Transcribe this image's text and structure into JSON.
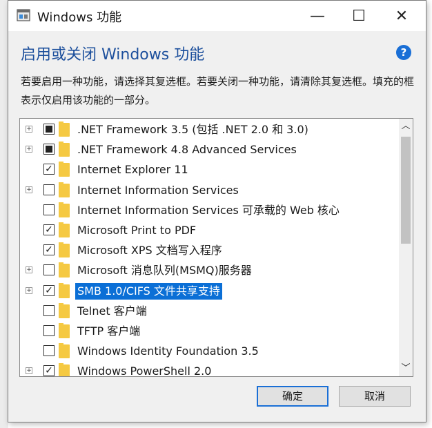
{
  "window": {
    "title": "Windows 功能",
    "controls": {
      "minimize": "—",
      "maximize": "☐",
      "close": "✕"
    }
  },
  "heading": "启用或关闭 Windows 功能",
  "help_icon": "?",
  "description": "若要启用一种功能，请选择其复选框。若要关闭一种功能，请清除其复选框。填充的框表示仅启用该功能的一部分。",
  "features": [
    {
      "label": ".NET Framework 3.5 (包括 .NET 2.0 和 3.0)",
      "state": "partial",
      "expandable": true
    },
    {
      "label": ".NET Framework 4.8 Advanced Services",
      "state": "partial",
      "expandable": true
    },
    {
      "label": "Internet Explorer 11",
      "state": "checked",
      "expandable": false
    },
    {
      "label": "Internet Information Services",
      "state": "unchecked",
      "expandable": true
    },
    {
      "label": "Internet Information Services 可承载的 Web 核心",
      "state": "unchecked",
      "expandable": false
    },
    {
      "label": "Microsoft Print to PDF",
      "state": "checked",
      "expandable": false
    },
    {
      "label": "Microsoft XPS 文档写入程序",
      "state": "checked",
      "expandable": false
    },
    {
      "label": "Microsoft 消息队列(MSMQ)服务器",
      "state": "unchecked",
      "expandable": true
    },
    {
      "label": "SMB 1.0/CIFS 文件共享支持",
      "state": "checked",
      "expandable": true,
      "selected": true
    },
    {
      "label": "Telnet 客户端",
      "state": "unchecked",
      "expandable": false
    },
    {
      "label": "TFTP 客户端",
      "state": "unchecked",
      "expandable": false
    },
    {
      "label": "Windows Identity Foundation 3.5",
      "state": "unchecked",
      "expandable": false
    },
    {
      "label": "Windows PowerShell 2.0",
      "state": "checked",
      "expandable": true
    }
  ],
  "buttons": {
    "ok": "确定",
    "cancel": "取消"
  },
  "colors": {
    "heading": "#1c4f9c",
    "selection": "#0b6fd6",
    "folder": "#f5c942",
    "accent": "#1a6fd6"
  }
}
